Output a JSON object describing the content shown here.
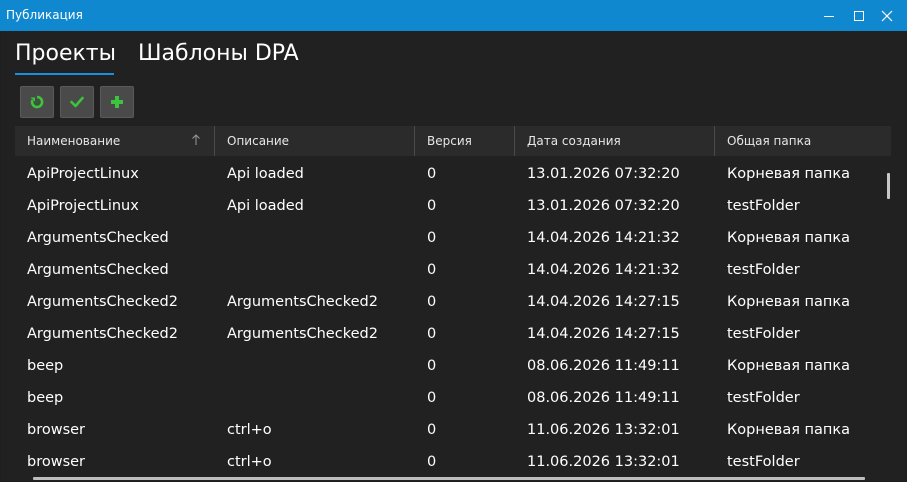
{
  "window": {
    "title": "Публикация",
    "controls": {
      "minimize": "—",
      "maximize": "□",
      "close": "✕"
    }
  },
  "tabs": [
    {
      "label": "Проекты",
      "active": true
    },
    {
      "label": "Шаблоны DPA",
      "active": false
    }
  ],
  "toolbar": {
    "buttons": [
      {
        "icon": "refresh-icon",
        "color": "#3cc43c"
      },
      {
        "icon": "checkmark-icon",
        "color": "#3cc43c"
      },
      {
        "icon": "plus-icon",
        "color": "#3cc43c"
      }
    ]
  },
  "grid": {
    "columns": [
      "Наименование",
      "Описание",
      "Версия",
      "Дата создания",
      "Общая папка"
    ],
    "sort_column": "Наименование",
    "sort_direction": "ascending",
    "rows": [
      [
        "ApiProjectLinux",
        "Api loaded",
        "0",
        "13.01.2026 07:32:20",
        "Корневая папка"
      ],
      [
        "ApiProjectLinux",
        "Api loaded",
        "0",
        "13.01.2026 07:32:20",
        "testFolder"
      ],
      [
        "ArgumentsChecked",
        "",
        "0",
        "14.04.2026 14:21:32",
        "Корневая папка"
      ],
      [
        "ArgumentsChecked",
        "",
        "0",
        "14.04.2026 14:21:32",
        "testFolder"
      ],
      [
        "ArgumentsChecked2",
        "ArgumentsChecked2",
        "0",
        "14.04.2026 14:27:15",
        "Корневая папка"
      ],
      [
        "ArgumentsChecked2",
        "ArgumentsChecked2",
        "0",
        "14.04.2026 14:27:15",
        "testFolder"
      ],
      [
        "beep",
        "",
        "0",
        "08.06.2026 11:49:11",
        "Корневая папка"
      ],
      [
        "beep",
        "",
        "0",
        "08.06.2026 11:49:11",
        "testFolder"
      ],
      [
        "browser",
        "ctrl+o",
        "0",
        "11.06.2026 13:32:01",
        "Корневая папка"
      ],
      [
        "browser",
        "ctrl+o",
        "0",
        "11.06.2026 13:32:01",
        "testFolder"
      ]
    ]
  },
  "colors": {
    "titlebar": "#0f88cf",
    "background": "#222121",
    "header": "#2b2b2b",
    "accent": "#1a8fdc",
    "icon_green": "#3cc43c"
  }
}
